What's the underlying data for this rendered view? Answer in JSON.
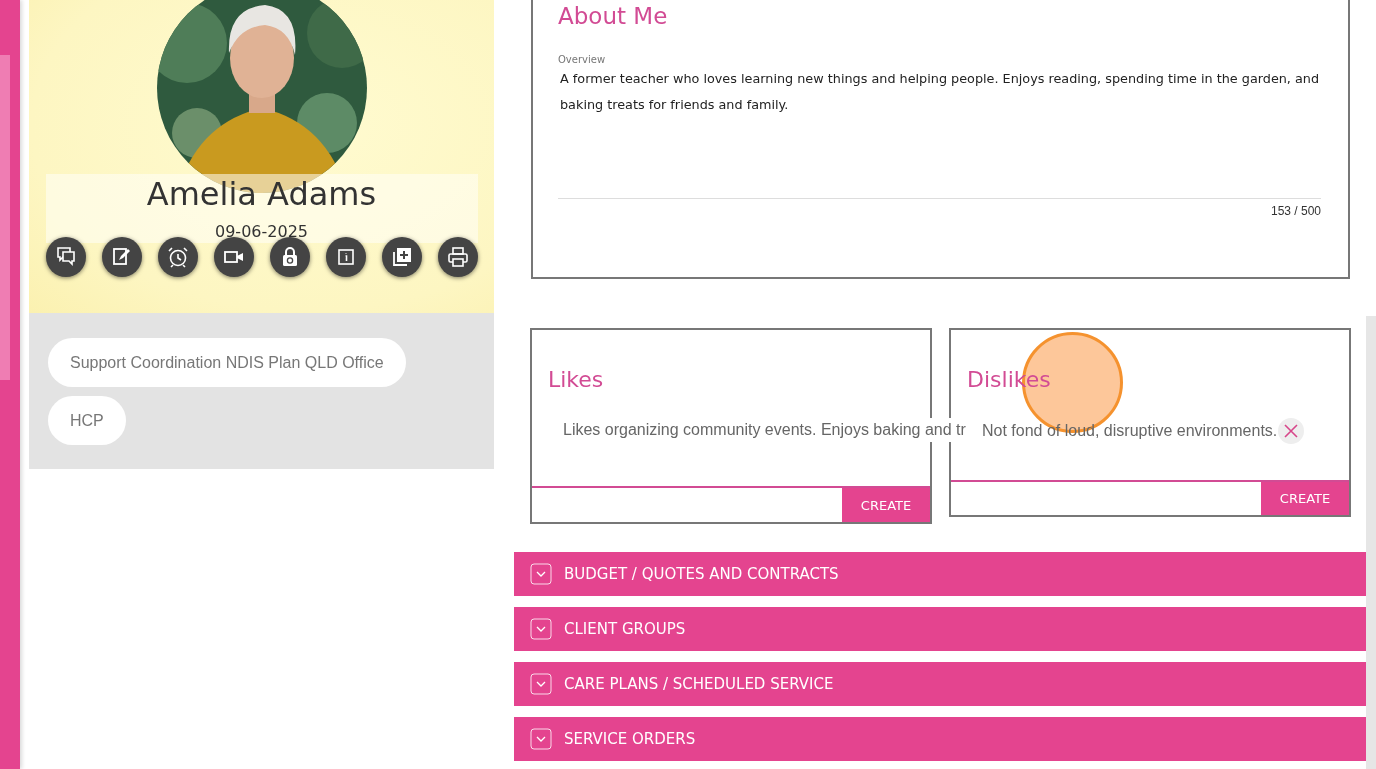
{
  "profile": {
    "name": "Amelia Adams",
    "date": "09-06-2025",
    "actions": [
      {
        "kind": "chat"
      },
      {
        "kind": "note"
      },
      {
        "kind": "alarm"
      },
      {
        "kind": "video"
      },
      {
        "kind": "lock"
      },
      {
        "kind": "info"
      },
      {
        "kind": "add"
      },
      {
        "kind": "print"
      }
    ]
  },
  "tags": [
    "Support Coordination NDIS Plan QLD Office",
    "HCP"
  ],
  "about": {
    "title": "About Me",
    "label": "Overview",
    "text": "A former teacher who loves learning new things and helping people. Enjoys reading, spending time in the garden, and baking treats for friends and family.",
    "counter": "153 / 500"
  },
  "likes": {
    "title": "Likes",
    "items": [
      {
        "text": "Likes organizing community events. Enjoys baking and tr",
        "removable": false
      }
    ],
    "button": "CREATE"
  },
  "dislikes": {
    "title": "Dislikes",
    "items": [
      {
        "text": "Not fond of loud, disruptive environments.",
        "removable": true
      }
    ],
    "button": "CREATE"
  },
  "sections": [
    {
      "title": "BUDGET / QUOTES AND CONTRACTS",
      "expanded": false
    },
    {
      "title": "CLIENT GROUPS",
      "expanded": false
    },
    {
      "title": "CARE PLANS / SCHEDULED SERVICE",
      "expanded": false
    },
    {
      "title": "SERVICE ORDERS",
      "expanded": false
    }
  ]
}
